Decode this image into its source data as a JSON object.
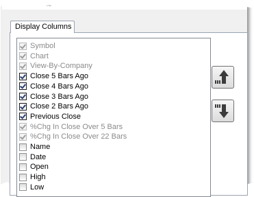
{
  "window": {
    "title_fragment": "Re"
  },
  "tab": {
    "label": "Display Columns"
  },
  "columns": [
    {
      "label": "Symbol",
      "checked": true,
      "enabled": false
    },
    {
      "label": "Chart",
      "checked": true,
      "enabled": false
    },
    {
      "label": "View-By-Company",
      "checked": true,
      "enabled": false
    },
    {
      "label": "Close 5 Bars Ago",
      "checked": true,
      "enabled": true
    },
    {
      "label": "Close 4 Bars Ago",
      "checked": true,
      "enabled": true
    },
    {
      "label": "Close 3 Bars Ago",
      "checked": true,
      "enabled": true
    },
    {
      "label": "Close 2 Bars Ago",
      "checked": true,
      "enabled": true
    },
    {
      "label": "Previous Close",
      "checked": true,
      "enabled": true
    },
    {
      "label": "%Chg In Close Over 5 Bars",
      "checked": true,
      "enabled": false
    },
    {
      "label": "%Chg In Close Over 22 Bars",
      "checked": true,
      "enabled": false
    },
    {
      "label": "Name",
      "checked": false,
      "enabled": true
    },
    {
      "label": "Date",
      "checked": false,
      "enabled": true
    },
    {
      "label": "Open",
      "checked": false,
      "enabled": true
    },
    {
      "label": "High",
      "checked": false,
      "enabled": true
    },
    {
      "label": "Low",
      "checked": false,
      "enabled": true
    }
  ],
  "buttons": {
    "move_up_icon": "arrow-up-icon",
    "move_down_icon": "arrow-down-icon"
  },
  "colors": {
    "dialog_bg": "#f0f0f0",
    "panel_bg": "#ffffff",
    "arrow": "#3c3c3c",
    "disabled_text": "#8a8a8a"
  }
}
